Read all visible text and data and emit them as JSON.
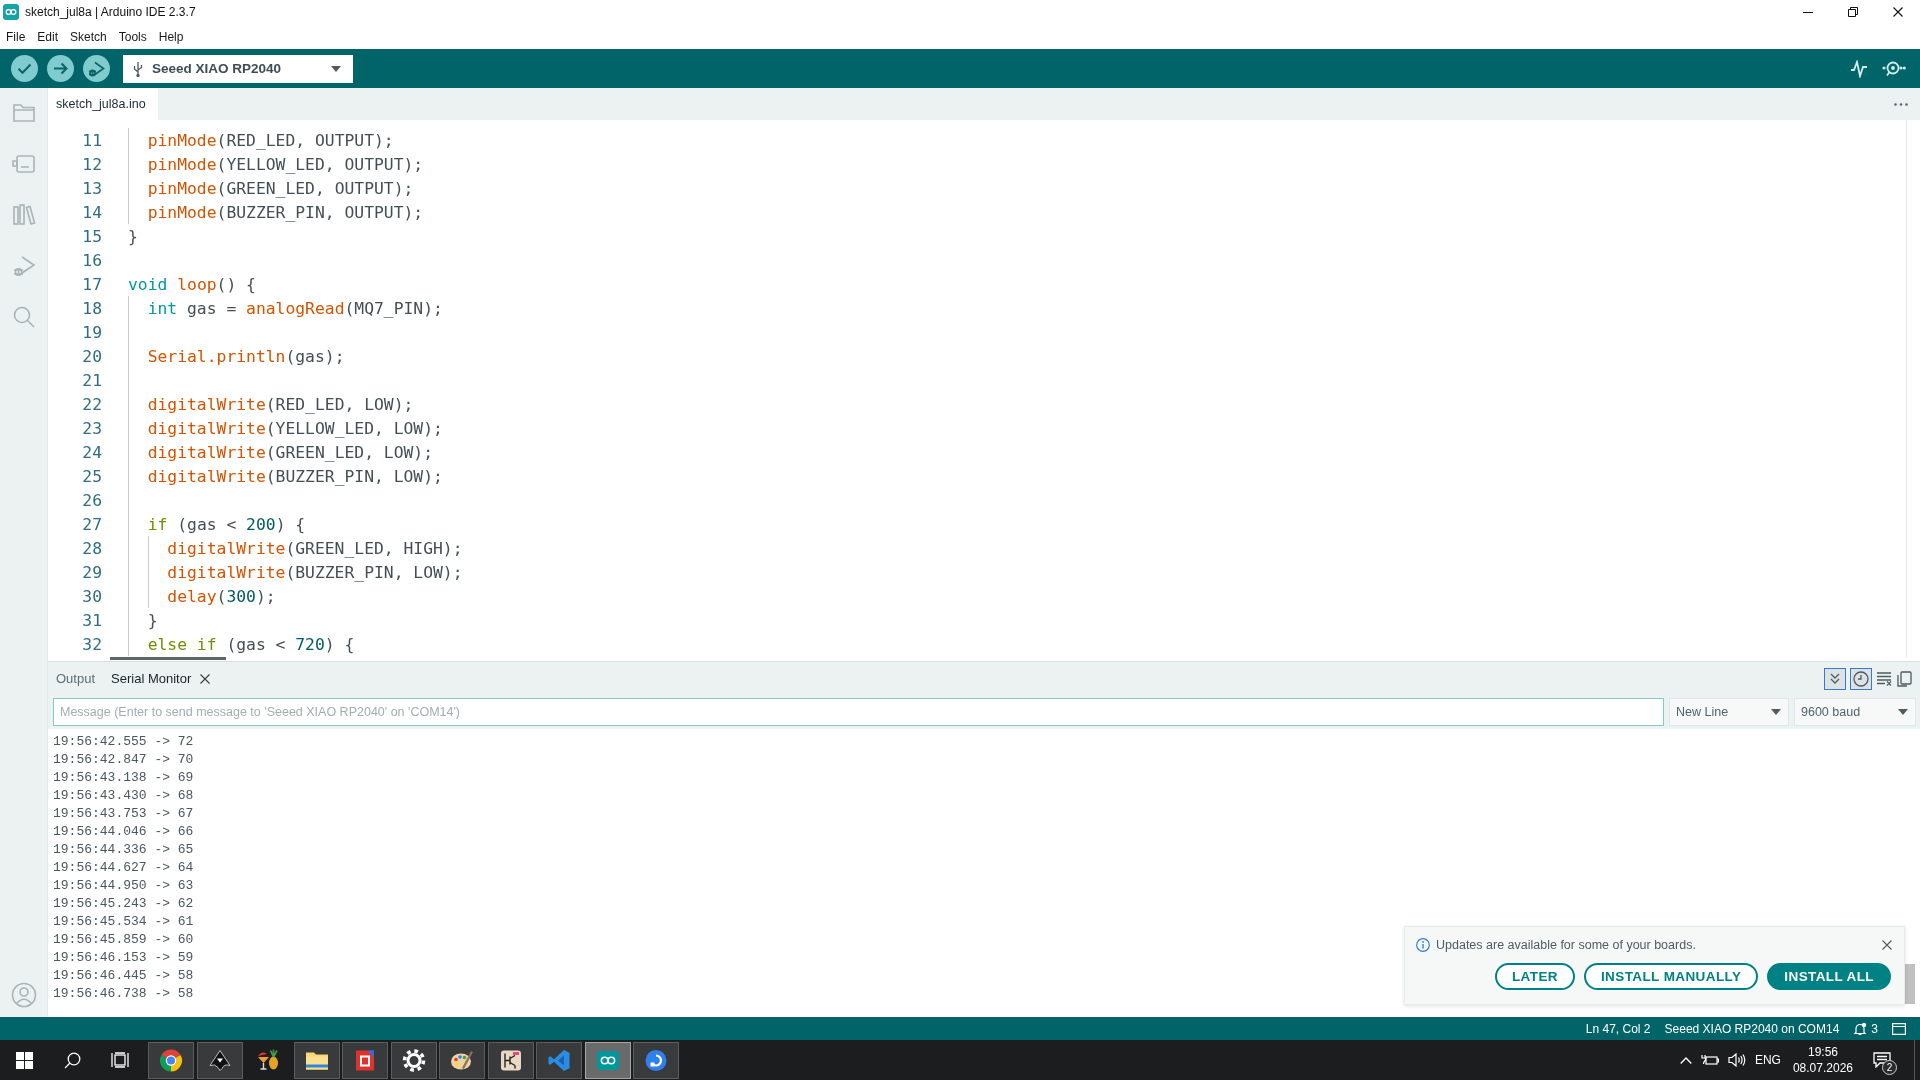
{
  "window": {
    "title": "sketch_jul8a | Arduino IDE 2.3.7"
  },
  "menu": [
    "File",
    "Edit",
    "Sketch",
    "Tools",
    "Help"
  ],
  "toolbar": {
    "board": "Seeed XIAO RP2040"
  },
  "tabs": [
    {
      "label": "sketch_jul8a.ino",
      "selected": true
    }
  ],
  "editor": {
    "lines": [
      {
        "number": "11",
        "code": [
          {
            "kind": "function",
            "text": "  pinMode"
          },
          {
            "kind": "plain",
            "text": "(RED_LED, OUTPUT);"
          }
        ]
      },
      {
        "number": "12",
        "code": [
          {
            "kind": "function",
            "text": "  pinMode"
          },
          {
            "kind": "plain",
            "text": "(YELLOW_LED, OUTPUT);"
          }
        ]
      },
      {
        "number": "13",
        "code": [
          {
            "kind": "function",
            "text": "  pinMode"
          },
          {
            "kind": "plain",
            "text": "(GREEN_LED, OUTPUT);"
          }
        ]
      },
      {
        "number": "14",
        "code": [
          {
            "kind": "function",
            "text": "  pinMode"
          },
          {
            "kind": "plain",
            "text": "(BUZZER_PIN, OUTPUT);"
          }
        ]
      },
      {
        "number": "15",
        "code": [
          {
            "kind": "plain",
            "text": "}"
          }
        ]
      },
      {
        "number": "16"
      },
      {
        "number": "17",
        "code": [
          {
            "kind": "type",
            "text": "void "
          },
          {
            "kind": "function",
            "text": "loop"
          },
          {
            "kind": "plain",
            "text": "() {"
          }
        ]
      },
      {
        "number": "18",
        "code": [
          {
            "kind": "type",
            "text": "  int "
          },
          {
            "kind": "plain",
            "text": "gas = "
          },
          {
            "kind": "function",
            "text": "analogRead"
          },
          {
            "kind": "plain",
            "text": "(MQ7_PIN);"
          }
        ]
      },
      {
        "number": "19"
      },
      {
        "number": "20",
        "code": [
          {
            "kind": "function",
            "text": "  Serial.println"
          },
          {
            "kind": "plain",
            "text": "(gas);"
          }
        ]
      },
      {
        "number": "21"
      },
      {
        "number": "22",
        "code": [
          {
            "kind": "function",
            "text": "  digitalWrite"
          },
          {
            "kind": "plain",
            "text": "(RED_LED, LOW);"
          }
        ]
      },
      {
        "number": "23",
        "code": [
          {
            "kind": "function",
            "text": "  digitalWrite"
          },
          {
            "kind": "plain",
            "text": "(YELLOW_LED, LOW);"
          }
        ]
      },
      {
        "number": "24",
        "code": [
          {
            "kind": "function",
            "text": "  digitalWrite"
          },
          {
            "kind": "plain",
            "text": "(GREEN_LED, LOW);"
          }
        ]
      },
      {
        "number": "25",
        "code": [
          {
            "kind": "function",
            "text": "  digitalWrite"
          },
          {
            "kind": "plain",
            "text": "(BUZZER_PIN, LOW);"
          }
        ]
      },
      {
        "number": "26"
      },
      {
        "number": "27",
        "code": [
          {
            "kind": "control",
            "text": "  if "
          },
          {
            "kind": "plain",
            "text": "(gas < "
          },
          {
            "kind": "number",
            "text": "200"
          },
          {
            "kind": "plain",
            "text": ") {"
          }
        ]
      },
      {
        "number": "28",
        "code": [
          {
            "kind": "function",
            "text": "    digitalWrite"
          },
          {
            "kind": "plain",
            "text": "(GREEN_LED, HIGH);"
          }
        ]
      },
      {
        "number": "29",
        "code": [
          {
            "kind": "function",
            "text": "    digitalWrite"
          },
          {
            "kind": "plain",
            "text": "(BUZZER_PIN, LOW);"
          }
        ]
      },
      {
        "number": "30",
        "code": [
          {
            "kind": "function",
            "text": "    delay"
          },
          {
            "kind": "plain",
            "text": "("
          },
          {
            "kind": "number",
            "text": "300"
          },
          {
            "kind": "plain",
            "text": ");"
          }
        ]
      },
      {
        "number": "31",
        "code": [
          {
            "kind": "plain",
            "text": "  }"
          }
        ]
      },
      {
        "number": "32",
        "code": [
          {
            "kind": "control",
            "text": "  else if "
          },
          {
            "kind": "plain",
            "text": "(gas < "
          },
          {
            "kind": "number",
            "text": "720"
          },
          {
            "kind": "plain",
            "text": ") {"
          }
        ]
      }
    ]
  },
  "panel": {
    "tabs": [
      {
        "label": "Output",
        "selected": false,
        "closable": false
      },
      {
        "label": "Serial Monitor",
        "selected": true,
        "closable": true
      }
    ],
    "toggles": [
      {
        "kind": "autoscroll",
        "on": true
      },
      {
        "kind": "timestamp",
        "on": true
      },
      {
        "kind": "clear",
        "on": false
      },
      {
        "kind": "copy",
        "on": false
      }
    ],
    "message": {
      "placeholder": "Message (Enter to send message to 'Seeed XIAO RP2040' on 'COM14')"
    },
    "line_ending": "New Line",
    "baud_rate": "9600 baud",
    "output": [
      "19:56:42.555 -> 72",
      "19:56:42.847 -> 70",
      "19:56:43.138 -> 69",
      "19:56:43.430 -> 68",
      "19:56:43.753 -> 67",
      "19:56:44.046 -> 66",
      "19:56:44.336 -> 65",
      "19:56:44.627 -> 64",
      "19:56:44.950 -> 63",
      "19:56:45.243 -> 62",
      "19:56:45.534 -> 61",
      "19:56:45.859 -> 60",
      "19:56:46.153 -> 59",
      "19:56:46.445 -> 58",
      "19:56:46.738 -> 58"
    ]
  },
  "notification": {
    "message": "Updates are available for some of your boards.",
    "buttons": [
      {
        "label": "LATER",
        "kind": "outline"
      },
      {
        "label": "INSTALL MANUALLY",
        "kind": "outline"
      },
      {
        "label": "INSTALL ALL",
        "kind": "primary"
      }
    ]
  },
  "status_bar": {
    "position": "Ln 47, Col 2",
    "board": "Seeed XIAO RP2040 on COM14",
    "notifications": "3"
  },
  "taskbar": {
    "apps": [
      {
        "kind": "browser",
        "running": true,
        "active": false
      },
      {
        "kind": "vector",
        "running": true,
        "active": false
      },
      {
        "kind": "cocktail",
        "running": false,
        "active": false
      },
      {
        "kind": "folder",
        "running": true,
        "active": false
      },
      {
        "kind": "logo",
        "running": true,
        "active": false
      },
      {
        "kind": "gear",
        "running": true,
        "active": false
      },
      {
        "kind": "palette",
        "running": true,
        "active": false
      },
      {
        "kind": "schematic",
        "running": true,
        "active": false
      },
      {
        "kind": "editor",
        "running": true,
        "active": false
      },
      {
        "kind": "infinity",
        "running": true,
        "active": true
      },
      {
        "kind": "bluecircle",
        "running": true,
        "active": false
      }
    ],
    "language": "ENG",
    "time": "19:56",
    "date": "08.07.2026",
    "notification_count": "2"
  }
}
